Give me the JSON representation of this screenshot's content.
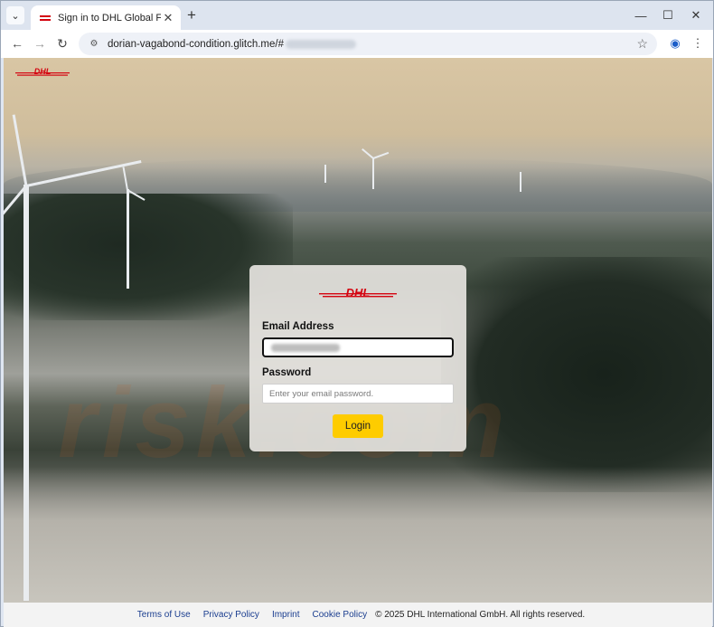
{
  "browser": {
    "tab_title": "Sign in to DHL Global Forwardi",
    "url": "dorian-vagabond-condition.glitch.me/#",
    "icons": {
      "tab_menu": "chevron-down-icon",
      "tab_close": "close-icon",
      "new_tab": "plus-icon",
      "minimize": "minimize-icon",
      "maximize": "maximize-icon",
      "close_window": "close-icon",
      "back": "arrow-left-icon",
      "forward": "arrow-right-icon",
      "reload": "reload-icon",
      "site_info": "tune-icon",
      "bookmark": "star-icon",
      "profile": "profile-icon",
      "menu": "kebab-menu-icon"
    }
  },
  "page": {
    "brand": "DHL",
    "brand_colors": {
      "red": "#d40511",
      "yellow": "#fecc00"
    },
    "login": {
      "email_label": "Email Address",
      "password_label": "Password",
      "password_placeholder": "Enter your email password.",
      "login_button": "Login"
    },
    "footer": {
      "links": [
        "Terms of Use",
        "Privacy Policy",
        "Imprint",
        "Cookie Policy"
      ],
      "copyright": "© 2025 DHL International GmbH. All rights reserved."
    }
  }
}
